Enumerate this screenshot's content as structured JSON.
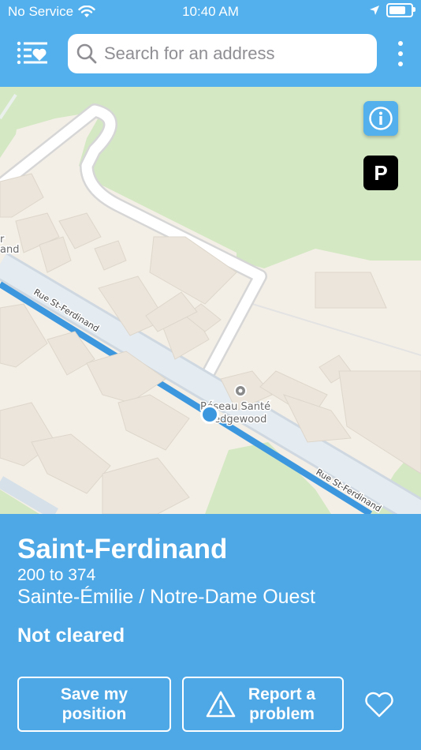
{
  "status_bar": {
    "carrier": "No Service",
    "time": "10:40 AM"
  },
  "search": {
    "placeholder": "Search for an address"
  },
  "map": {
    "labels": {
      "street_upper": "Rue St-Ferdinand",
      "street_lower": "Rue St-Ferdinand",
      "poi_line1": "Réseau Santé",
      "poi_line2": "Wedgewood",
      "edge_line1": "r",
      "edge_line2": "and"
    },
    "parking_label": "P"
  },
  "details": {
    "street": "Saint-Ferdinand",
    "address_range": "200 to 374",
    "between": "Sainte-Émilie / Notre-Dame Ouest",
    "status": "Not cleared",
    "save_label": "Save my position",
    "report_label": "Report a problem"
  },
  "colors": {
    "accent": "#4fa8e6",
    "route": "#3d97de",
    "park": "#d4e8c4",
    "land": "#f4efe6"
  },
  "icons": [
    "favorites-list-icon",
    "search-icon",
    "more-icon",
    "info-icon",
    "parking-icon",
    "location-dot-icon",
    "warning-icon",
    "heart-icon",
    "wifi-icon",
    "location-arrow-icon",
    "battery-icon"
  ]
}
